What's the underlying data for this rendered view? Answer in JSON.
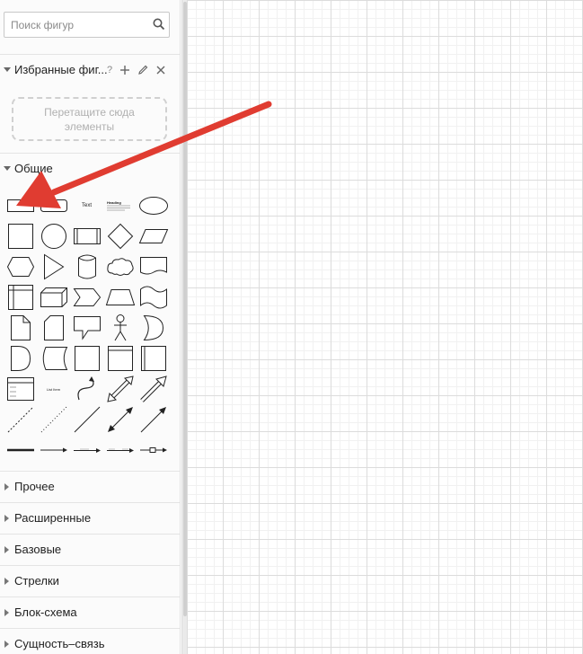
{
  "search": {
    "placeholder": "Поиск фигур",
    "value": ""
  },
  "favorites": {
    "title": "Избранные фиг...",
    "help_mark": "?",
    "dropzone_text": "Перетащите сюда элементы"
  },
  "general": {
    "title": "Общие",
    "expanded": true,
    "shape_text_label": "Text",
    "shape_heading_label": "Heading",
    "shape_list_label": "List Item"
  },
  "collapsed_sections": [
    {
      "label": "Прочее"
    },
    {
      "label": "Расширенные"
    },
    {
      "label": "Базовые"
    },
    {
      "label": "Стрелки"
    },
    {
      "label": "Блок-схема"
    },
    {
      "label": "Сущность–связь"
    }
  ],
  "colors": {
    "annotation_arrow": "#e03c31",
    "grid_major": "#dcdcdc",
    "grid_minor": "#f1f1f1"
  }
}
